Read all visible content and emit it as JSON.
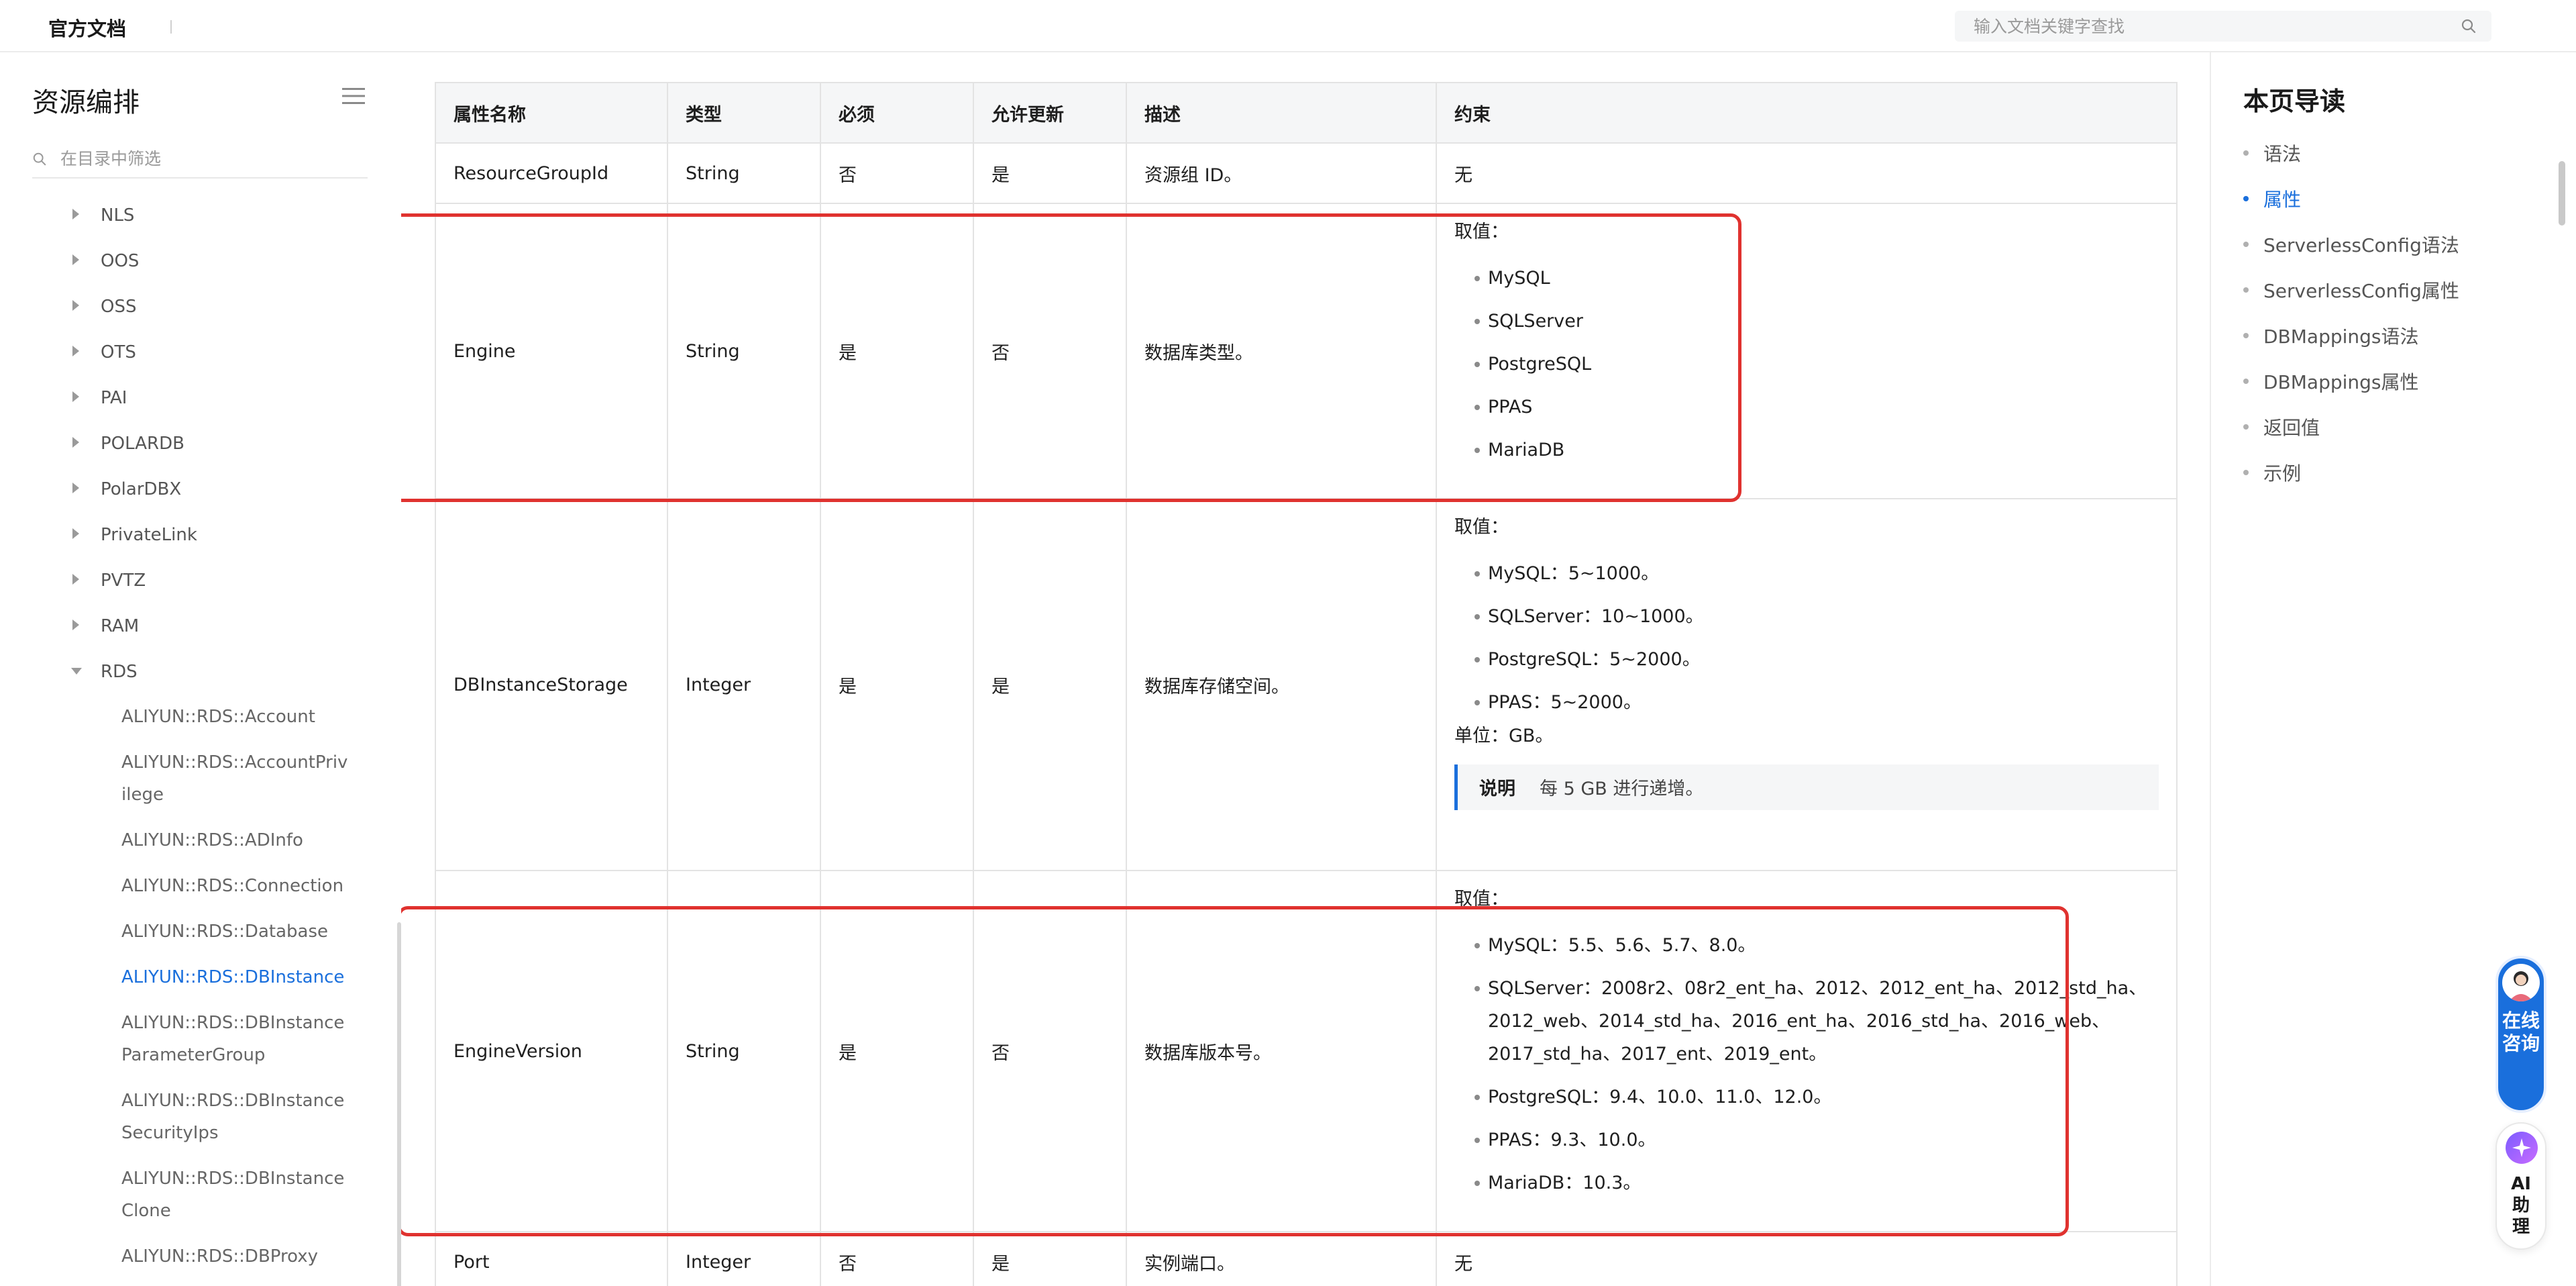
{
  "topbar": {
    "brand": "官方文档",
    "search_placeholder": "输入文档关键字查找"
  },
  "sidebar": {
    "title": "资源编排",
    "filter_placeholder": "在目录中筛选",
    "groups": [
      "NLS",
      "OOS",
      "OSS",
      "OTS",
      "PAI",
      "POLARDB",
      "PolarDBX",
      "PrivateLink",
      "PVTZ",
      "RAM"
    ],
    "open_group": "RDS",
    "rds_items": [
      {
        "l1": "ALIYUN::RDS::Account",
        "l2": ""
      },
      {
        "l1": "ALIYUN::RDS::AccountPriv",
        "l2": "ilege"
      },
      {
        "l1": "ALIYUN::RDS::ADInfo",
        "l2": ""
      },
      {
        "l1": "ALIYUN::RDS::Connection",
        "l2": ""
      },
      {
        "l1": "ALIYUN::RDS::Database",
        "l2": ""
      },
      {
        "l1": "ALIYUN::RDS::DBInstance",
        "l2": ""
      },
      {
        "l1": "ALIYUN::RDS::DBInstance",
        "l2": "ParameterGroup"
      },
      {
        "l1": "ALIYUN::RDS::DBInstance",
        "l2": "SecurityIps"
      },
      {
        "l1": "ALIYUN::RDS::DBInstance",
        "l2": "Clone"
      },
      {
        "l1": "ALIYUN::RDS::DBProxy",
        "l2": ""
      }
    ],
    "active_index": 5
  },
  "table": {
    "headers": [
      "属性名称",
      "类型",
      "必须",
      "允许更新",
      "描述",
      "约束"
    ],
    "rows": [
      {
        "name": "ResourceGroupId",
        "type": "String",
        "required": "否",
        "updatable": "是",
        "desc": "资源组 ID。",
        "constraint": "无"
      },
      {
        "name": "Engine",
        "type": "String",
        "required": "是",
        "updatable": "否",
        "desc": "数据库类型。",
        "cons_label": "取值：",
        "values": [
          "MySQL",
          "SQLServer",
          "PostgreSQL",
          "PPAS",
          "MariaDB"
        ]
      },
      {
        "name": "DBInstanceStorage",
        "type": "Integer",
        "required": "是",
        "updatable": "是",
        "desc": "数据库存储空间。",
        "cons_label": "取值：",
        "values": [
          "MySQL：5~1000。",
          "SQLServer：10~1000。",
          "PostgreSQL：5~2000。",
          "PPAS：5~2000。"
        ],
        "unit": "单位：GB。",
        "note_title": "说明",
        "note_text": "每 5 GB 进行递增。"
      },
      {
        "name": "EngineVersion",
        "type": "String",
        "required": "是",
        "updatable": "否",
        "desc": "数据库版本号。",
        "cons_label": "取值：",
        "values": [
          "MySQL：5.5、5.6、5.7、8.0。",
          "SQLServer：2008r2、08r2_ent_ha、2012、2012_ent_ha、2012_std_ha、2012_web、2014_std_ha、2016_ent_ha、2016_std_ha、2016_web、2017_std_ha、2017_ent、2019_ent。",
          "PostgreSQL：9.4、10.0、11.0、12.0。",
          "PPAS：9.3、10.0。",
          "MariaDB：10.3。"
        ]
      },
      {
        "name": "Port",
        "type": "Integer",
        "required": "否",
        "updatable": "是",
        "desc": "实例端口。",
        "constraint": "无"
      }
    ]
  },
  "toc": {
    "title": "本页导读",
    "items": [
      "语法",
      "属性",
      "ServerlessConfig语法",
      "ServerlessConfig属性",
      "DBMappings语法",
      "DBMappings属性",
      "返回值",
      "示例"
    ],
    "active_index": 1
  },
  "floating": {
    "consult": "在线咨询",
    "ai": "AI助理"
  },
  "colors": {
    "accent": "#1a6fdc",
    "highlight": "#e0322f"
  }
}
